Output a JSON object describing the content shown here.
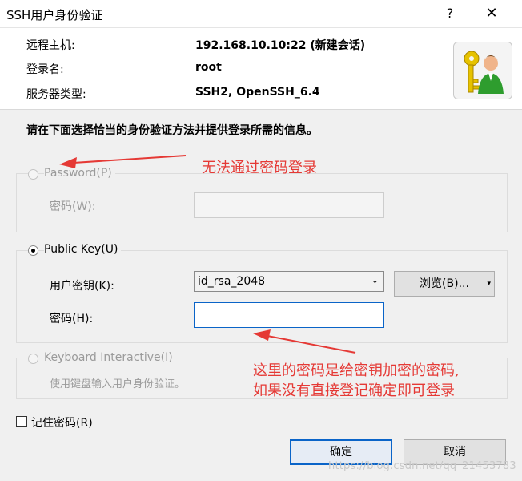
{
  "window": {
    "title": "SSH用户身份验证",
    "help_icon": "?",
    "close_icon": "✕"
  },
  "info": {
    "remote_host_label": "远程主机:",
    "remote_host_value": "192.168.10.10:22 (新建会话)",
    "login_name_label": "登录名:",
    "login_name_value": "root",
    "server_type_label": "服务器类型:",
    "server_type_value": "SSH2, OpenSSH_6.4",
    "avatar_icon": "key-user-icon"
  },
  "instruction": "请在下面选择恰当的身份验证方法并提供登录所需的信息。",
  "password_group": {
    "label": "Password(P)",
    "password_label": "密码(W):",
    "password_value": ""
  },
  "public_key_group": {
    "label": "Public Key(U)",
    "user_key_label": "用户密钥(K):",
    "user_key_value": "id_rsa_2048",
    "browse_label": "浏览(B)...",
    "password_label": "密码(H):",
    "password_value": ""
  },
  "keyboard_group": {
    "label": "Keyboard Interactive(I)",
    "desc": "使用键盘输入用户身份验证。"
  },
  "remember_password": "记住密码(R)",
  "buttons": {
    "ok": "确定",
    "cancel": "取消"
  },
  "annotations": {
    "note1": "无法通过密码登录",
    "note2_line1": "这里的密码是给密钥加密的密码,",
    "note2_line2": "如果没有直接登记确定即可登录"
  },
  "watermark": "https://blog.csdn.net/qq_21453783",
  "colors": {
    "annotation": "#e53935",
    "focus_border": "#0a64c8"
  }
}
